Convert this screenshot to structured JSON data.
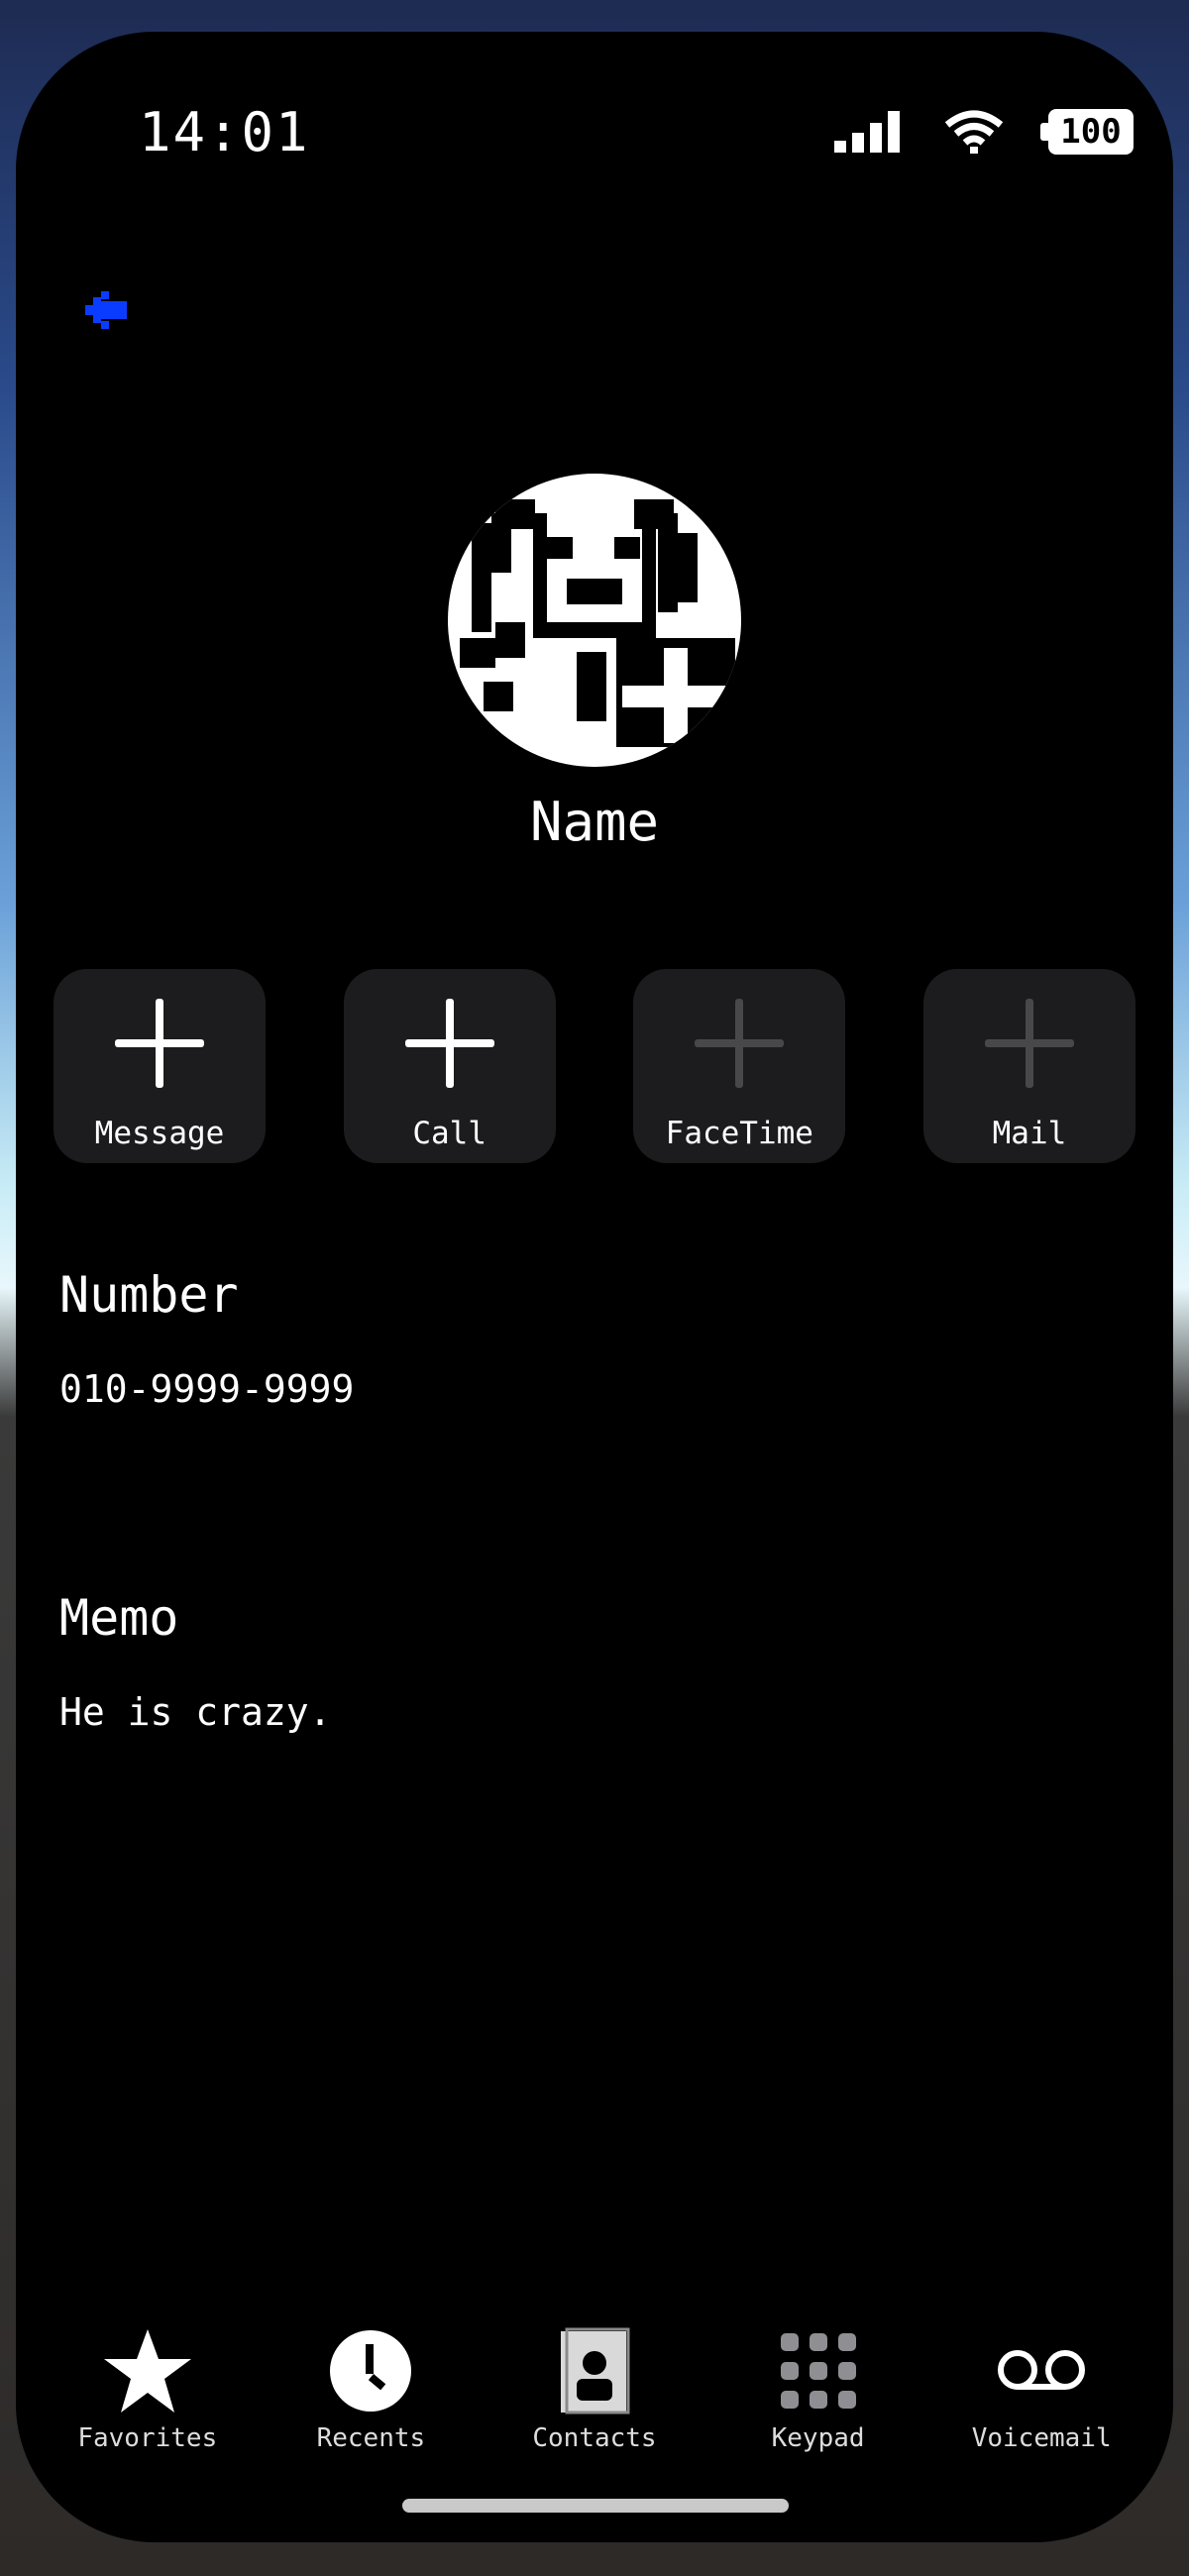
{
  "status": {
    "time": "14:01",
    "battery": "100"
  },
  "icons": {
    "back": "back-arrow-icon",
    "signal": "signal-icon",
    "wifi": "wifi-icon",
    "battery": "battery-icon",
    "avatar": "pixel-avatar-add-icon"
  },
  "colors": {
    "accent": "#0a3cff",
    "background": "#000000",
    "button_bg": "#1c1c1e",
    "disabled": "#48484a"
  },
  "contact": {
    "name": "Name"
  },
  "actions": [
    {
      "label": "Message",
      "enabled": true
    },
    {
      "label": "Call",
      "enabled": true
    },
    {
      "label": "FaceTime",
      "enabled": false
    },
    {
      "label": "Mail",
      "enabled": false
    }
  ],
  "number": {
    "title": "Number",
    "value": "010-9999-9999"
  },
  "memo": {
    "title": "Memo",
    "value": "He is crazy."
  },
  "tabs": [
    {
      "label": "Favorites",
      "icon": "star-icon"
    },
    {
      "label": "Recents",
      "icon": "clock-icon"
    },
    {
      "label": "Contacts",
      "icon": "contacts-icon"
    },
    {
      "label": "Keypad",
      "icon": "keypad-icon"
    },
    {
      "label": "Voicemail",
      "icon": "voicemail-icon"
    }
  ]
}
